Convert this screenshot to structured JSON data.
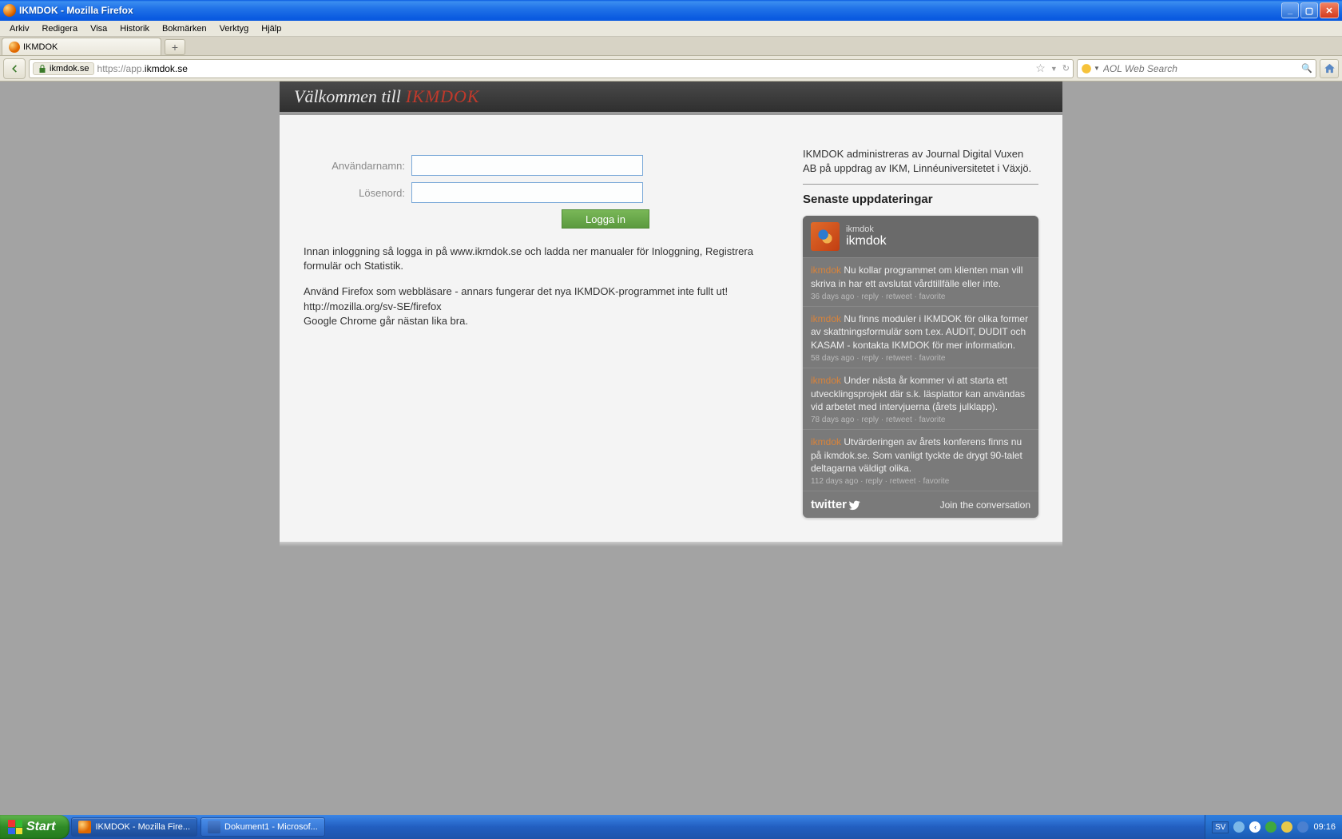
{
  "window": {
    "title": "IKMDOK - Mozilla Firefox"
  },
  "menubar": {
    "items": [
      "Arkiv",
      "Redigera",
      "Visa",
      "Historik",
      "Bokmärken",
      "Verktyg",
      "Hjälp"
    ]
  },
  "tab": {
    "label": "IKMDOK"
  },
  "addressbar": {
    "site": "ikmdok.se",
    "url_prefix": "https://app.",
    "url_domain": "ikmdok.se"
  },
  "searchbox": {
    "placeholder": "AOL Web Search"
  },
  "page": {
    "header_prefix": "Välkommen till",
    "header_brand": "IKMDOK",
    "form": {
      "username_label": "Användarnamn:",
      "password_label": "Lösenord:",
      "login_button": "Logga in"
    },
    "info_p1": "Innan inloggning så logga in på www.ikmdok.se och ladda ner manualer för Inloggning, Registrera formulär och Statistik.",
    "info_p2a": "Använd Firefox som webbläsare - annars fungerar det nya IKMDOK-programmet inte fullt ut!",
    "info_p2b": "http://mozilla.org/sv-SE/firefox",
    "info_p2c": "Google Chrome går nästan lika bra.",
    "side_admin": "IKMDOK administreras av Journal Digital Vuxen AB på uppdrag av IKM, Linnéuniversitetet i Växjö.",
    "side_heading": "Senaste uppdateringar",
    "twitter": {
      "name_small": "ikmdok",
      "name_big": "ikmdok",
      "items": [
        {
          "user": "ikmdok",
          "text": "Nu kollar programmet om klienten man vill skriva in har ett avslutat vårdtillfälle eller inte.",
          "age": "36 days ago"
        },
        {
          "user": "ikmdok",
          "text": "Nu finns moduler i IKMDOK för olika former av skattningsformulär som t.ex. AUDIT, DUDIT och KASAM - kontakta IKMDOK för mer information.",
          "age": "58 days ago"
        },
        {
          "user": "ikmdok",
          "text": "Under nästa år kommer vi att starta ett utvecklingsprojekt där s.k. läsplattor kan användas vid arbetet med intervjuerna (årets julklapp).",
          "age": "78 days ago"
        },
        {
          "user": "ikmdok",
          "text": "Utvärderingen av årets konferens finns nu på ikmdok.se. Som vanligt tyckte de drygt 90-talet deltagarna väldigt olika.",
          "age": "112 days ago"
        }
      ],
      "meta_links": [
        "reply",
        "retweet",
        "favorite"
      ],
      "logo_text": "twitter",
      "join_text": "Join the conversation"
    }
  },
  "taskbar": {
    "start": "Start",
    "items": [
      {
        "label": "IKMDOK - Mozilla Fire..."
      },
      {
        "label": "Dokument1 - Microsof..."
      }
    ],
    "lang": "SV",
    "time": "09:16"
  }
}
